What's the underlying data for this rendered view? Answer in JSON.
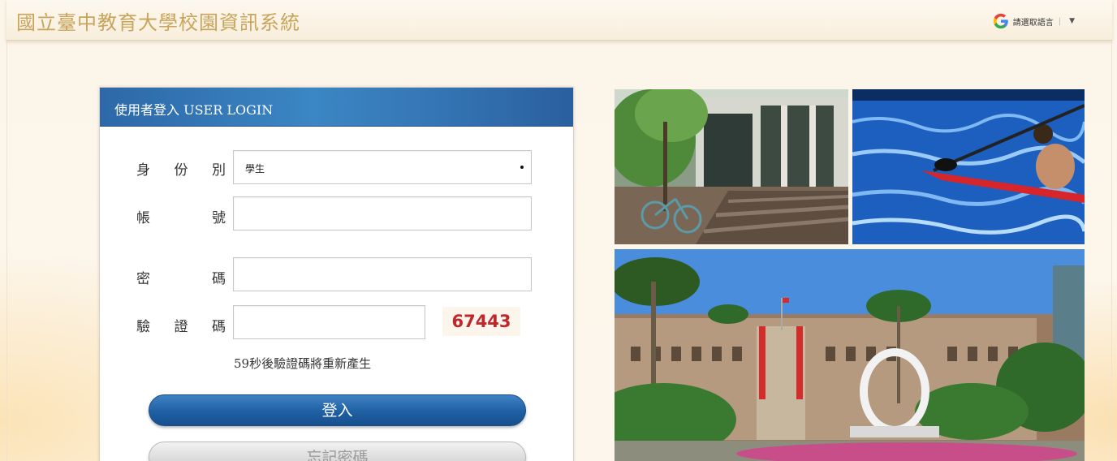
{
  "header": {
    "site_title": "國立臺中教育大學校園資訊系統",
    "translate_label": "請選取語言",
    "translate_divider": "|",
    "translate_caret": "▼"
  },
  "login": {
    "panel_title": "使用者登入 USER LOGIN",
    "identity_label": [
      "身",
      "份",
      "別"
    ],
    "identity_value": "學生",
    "account_label": [
      "帳",
      "號"
    ],
    "account_value": "",
    "password_label": [
      "密",
      "碼"
    ],
    "password_value": "",
    "captcha_label": [
      "驗",
      "證",
      "碼"
    ],
    "captcha_value": "",
    "captcha_code": "67443",
    "captcha_hint": "59秒後驗證碼將重新產生",
    "login_button": "登入",
    "forgot_button": "忘記密碼"
  },
  "colors": {
    "accent_blue": "#1f5fa3",
    "title_gold": "#c9a45b",
    "captcha_red": "#c0262a"
  },
  "icons": {
    "translate": "google-g-icon",
    "identity_dropdown": "dropdown-dot-icon"
  }
}
